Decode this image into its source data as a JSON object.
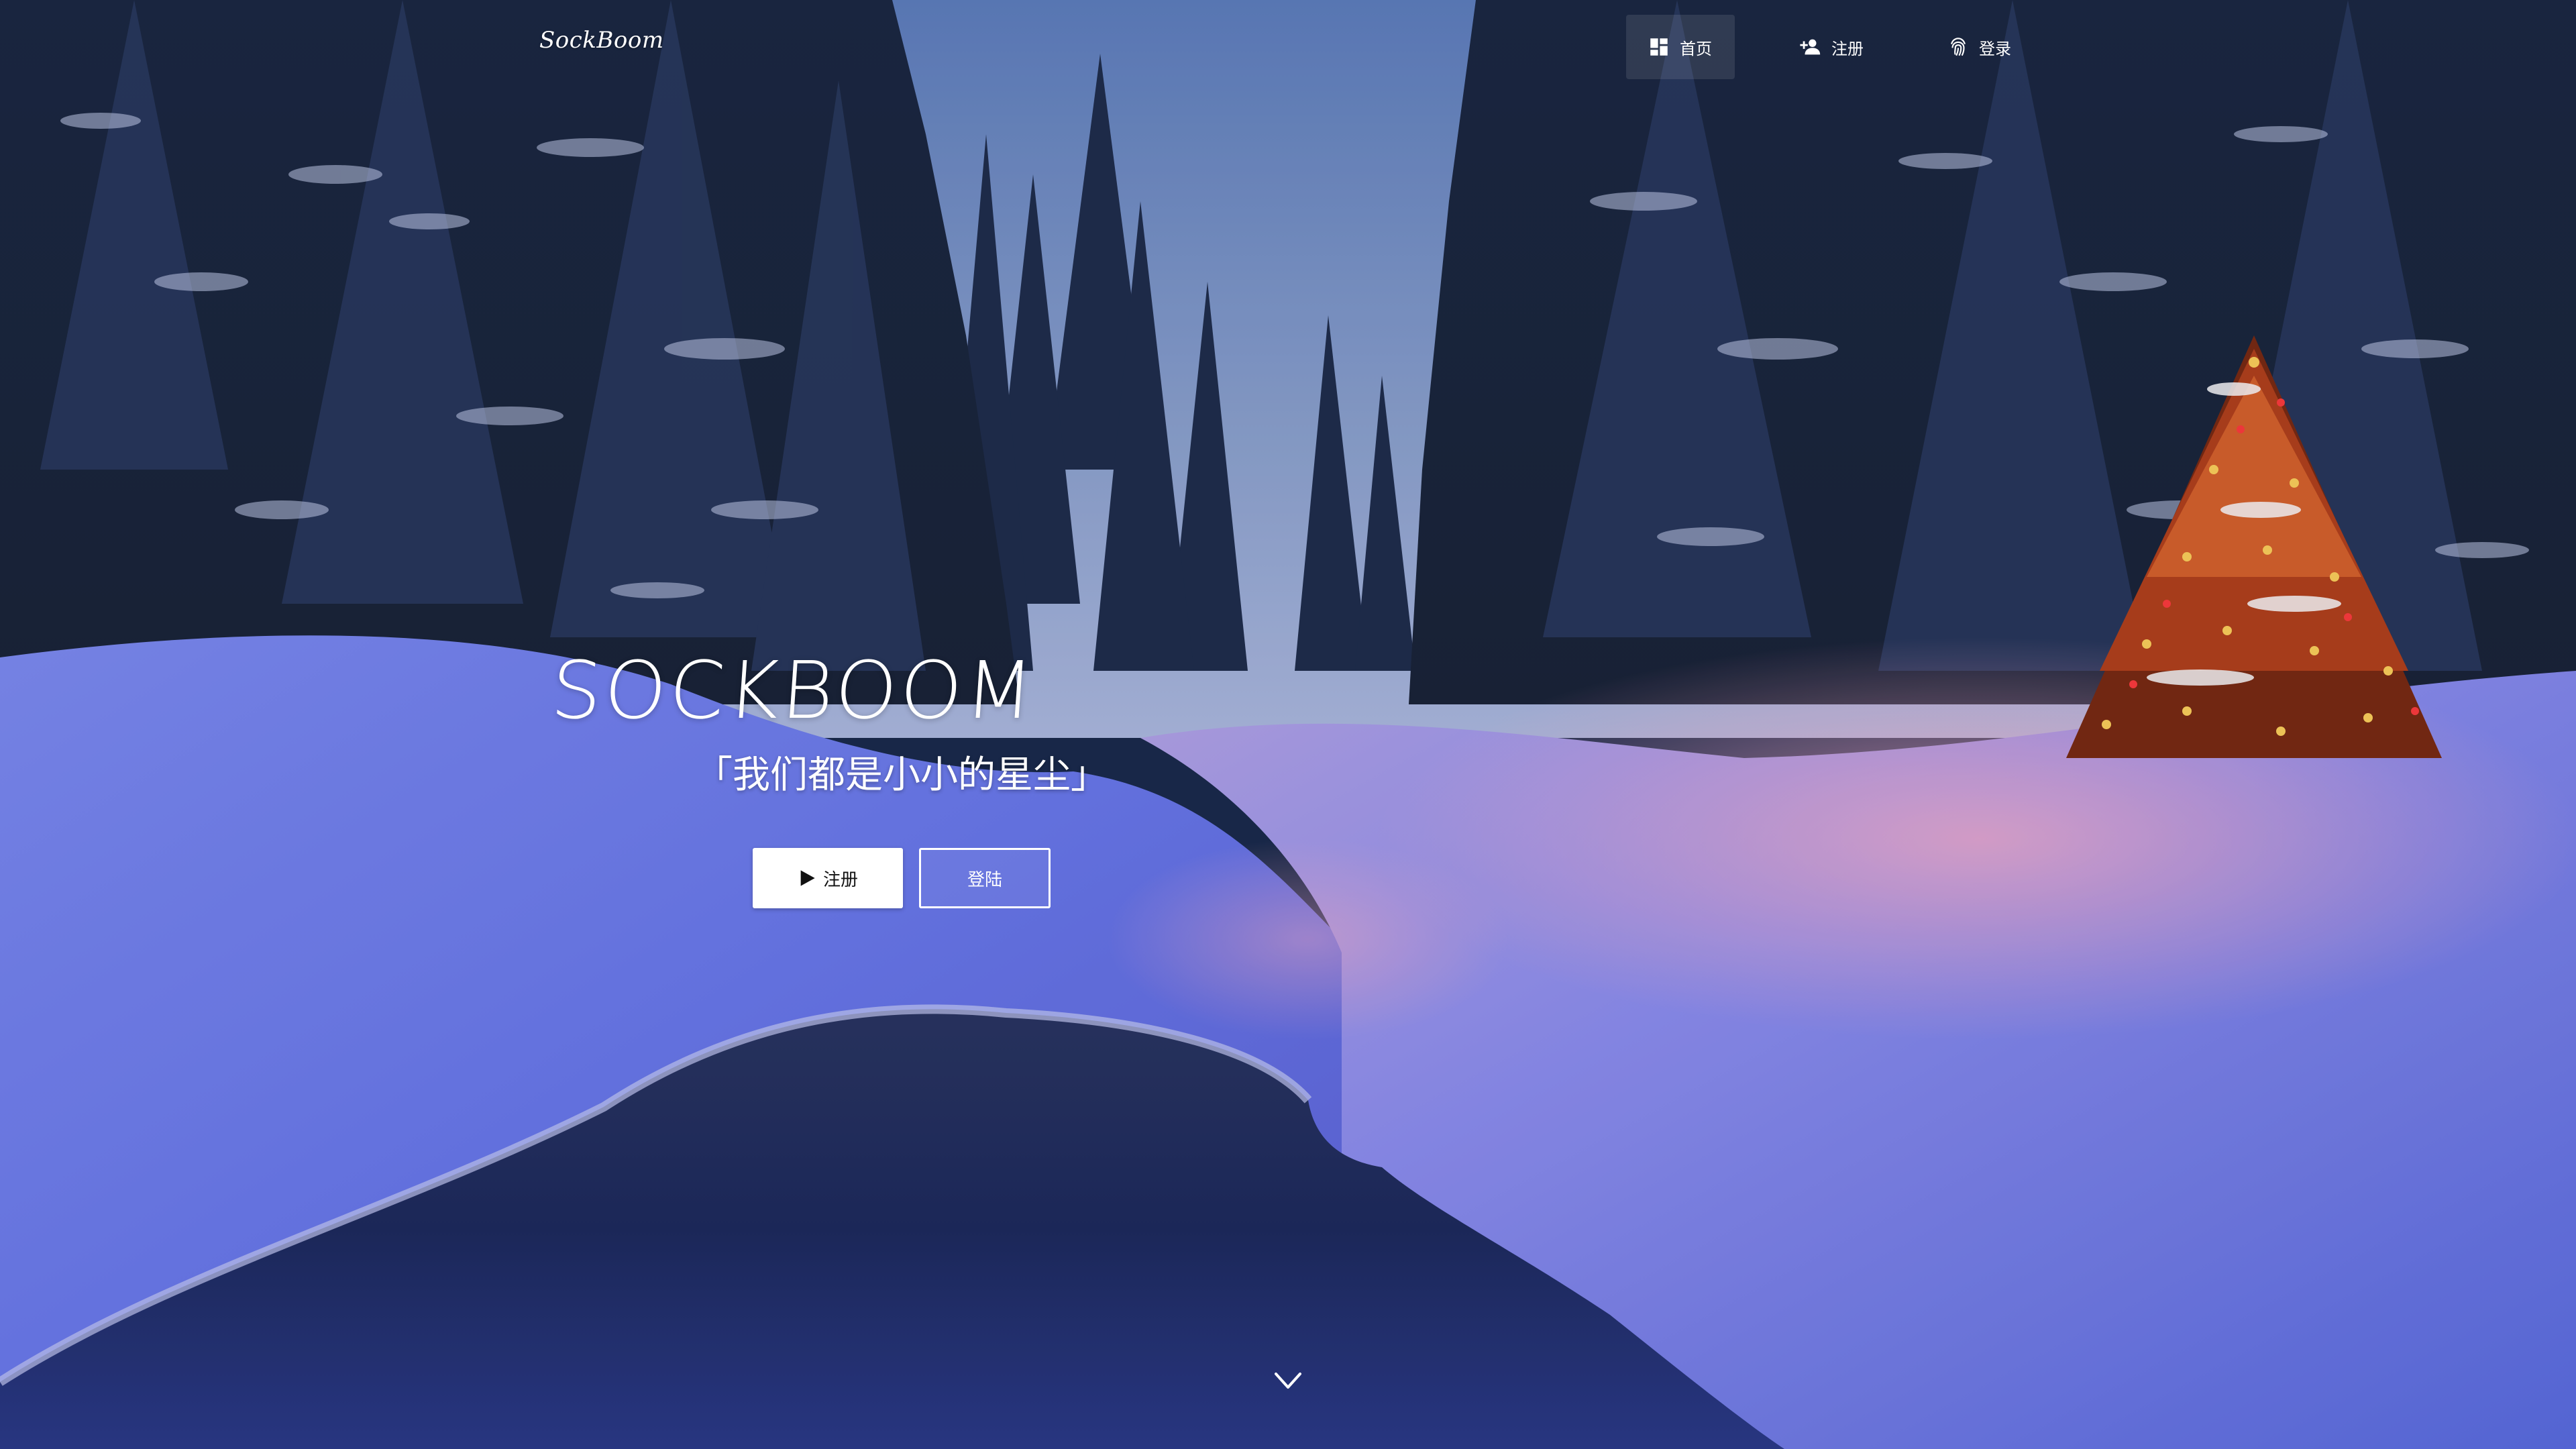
{
  "nav": {
    "brand": "SockBoom",
    "items": [
      {
        "label": "首页",
        "icon": "dashboard-icon",
        "active": true
      },
      {
        "label": "注册",
        "icon": "person-add-icon",
        "active": false
      },
      {
        "label": "登录",
        "icon": "fingerprint-icon",
        "active": false
      }
    ]
  },
  "hero": {
    "title": "SOCKBOOM",
    "subtitle": "「我们都是小小的星尘」",
    "register_button": "注册",
    "login_button": "登陆"
  },
  "icons": {
    "scroll": "chevron-down-icon",
    "play": "play-icon"
  },
  "colors": {
    "sky": "#4f6fae",
    "snow": "#6f7cf0",
    "water": "#1e2a52",
    "tree_lights": "#ff6a2a"
  }
}
